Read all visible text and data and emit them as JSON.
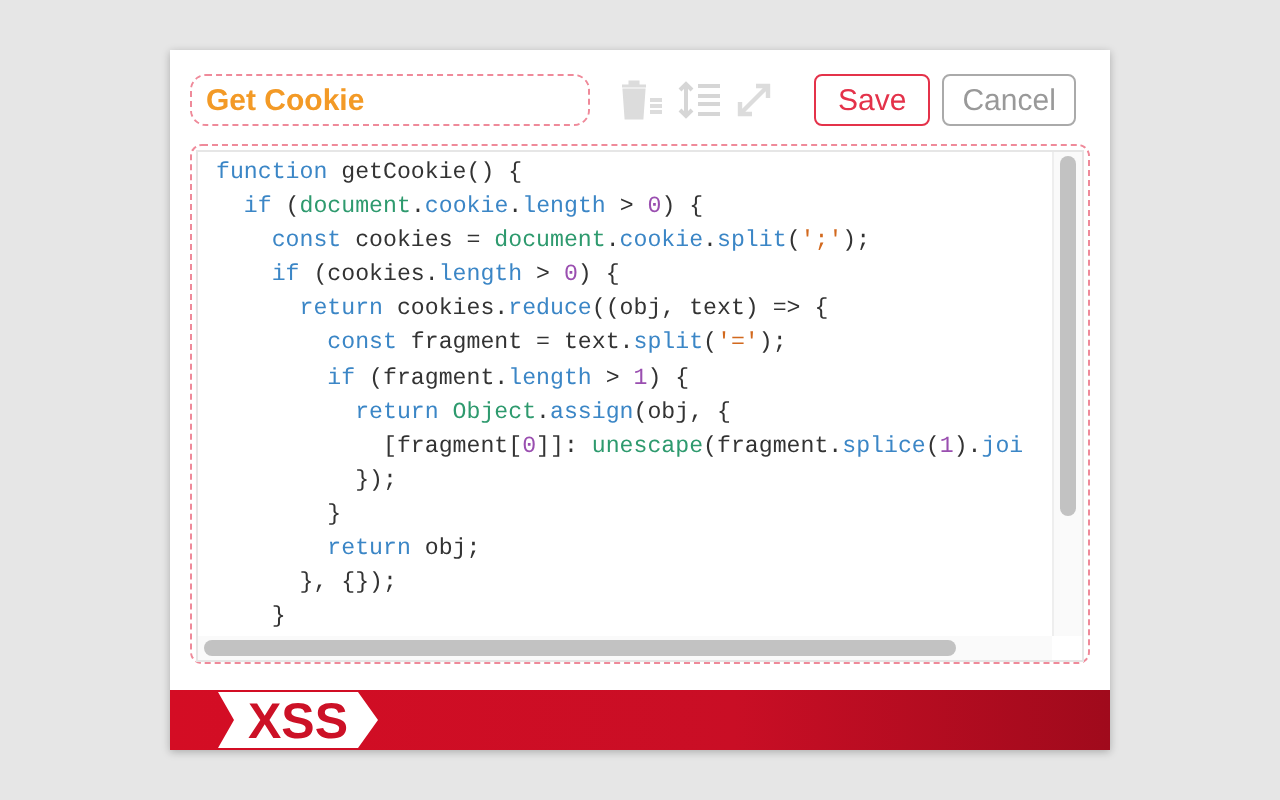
{
  "title_field": {
    "value": "Get Cookie"
  },
  "toolbar": {
    "save": "Save",
    "cancel": "Cancel"
  },
  "code_lines": [
    [
      {
        "t": "function",
        "kind": "keyword"
      },
      {
        "t": " getCookie() {",
        "kind": "plain"
      }
    ],
    [
      {
        "t": "  if",
        "kind": "keyword"
      },
      {
        "t": " (",
        "kind": "plain"
      },
      {
        "t": "document",
        "kind": "global"
      },
      {
        "t": ".",
        "kind": "plain"
      },
      {
        "t": "cookie",
        "kind": "property"
      },
      {
        "t": ".",
        "kind": "plain"
      },
      {
        "t": "length",
        "kind": "property"
      },
      {
        "t": " > ",
        "kind": "plain"
      },
      {
        "t": "0",
        "kind": "number"
      },
      {
        "t": ") {",
        "kind": "plain"
      }
    ],
    [
      {
        "t": "    const",
        "kind": "keyword"
      },
      {
        "t": " cookies = ",
        "kind": "plain"
      },
      {
        "t": "document",
        "kind": "global"
      },
      {
        "t": ".",
        "kind": "plain"
      },
      {
        "t": "cookie",
        "kind": "property"
      },
      {
        "t": ".",
        "kind": "plain"
      },
      {
        "t": "split",
        "kind": "property"
      },
      {
        "t": "(",
        "kind": "plain"
      },
      {
        "t": "';'",
        "kind": "string"
      },
      {
        "t": ");",
        "kind": "plain"
      }
    ],
    [
      {
        "t": "    if",
        "kind": "keyword"
      },
      {
        "t": " (cookies.",
        "kind": "plain"
      },
      {
        "t": "length",
        "kind": "property"
      },
      {
        "t": " > ",
        "kind": "plain"
      },
      {
        "t": "0",
        "kind": "number"
      },
      {
        "t": ") {",
        "kind": "plain"
      }
    ],
    [
      {
        "t": "      return",
        "kind": "keyword"
      },
      {
        "t": " cookies.",
        "kind": "plain"
      },
      {
        "t": "reduce",
        "kind": "property"
      },
      {
        "t": "((obj, text) => {",
        "kind": "plain"
      }
    ],
    [
      {
        "t": "        const",
        "kind": "keyword"
      },
      {
        "t": " fragment = text.",
        "kind": "plain"
      },
      {
        "t": "split",
        "kind": "property"
      },
      {
        "t": "(",
        "kind": "plain"
      },
      {
        "t": "'='",
        "kind": "string"
      },
      {
        "t": ");",
        "kind": "plain"
      }
    ],
    [
      {
        "t": "        if",
        "kind": "keyword"
      },
      {
        "t": " (fragment.",
        "kind": "plain"
      },
      {
        "t": "length",
        "kind": "property"
      },
      {
        "t": " > ",
        "kind": "plain"
      },
      {
        "t": "1",
        "kind": "number"
      },
      {
        "t": ") {",
        "kind": "plain"
      }
    ],
    [
      {
        "t": "          return ",
        "kind": "keyword"
      },
      {
        "t": "Object",
        "kind": "global"
      },
      {
        "t": ".",
        "kind": "plain"
      },
      {
        "t": "assign",
        "kind": "property"
      },
      {
        "t": "(obj, {",
        "kind": "plain"
      }
    ],
    [
      {
        "t": "            [fragment[",
        "kind": "plain"
      },
      {
        "t": "0",
        "kind": "number"
      },
      {
        "t": "]]: ",
        "kind": "plain"
      },
      {
        "t": "unescape",
        "kind": "global"
      },
      {
        "t": "(fragment.",
        "kind": "plain"
      },
      {
        "t": "splice",
        "kind": "property"
      },
      {
        "t": "(",
        "kind": "plain"
      },
      {
        "t": "1",
        "kind": "number"
      },
      {
        "t": ").",
        "kind": "plain"
      },
      {
        "t": "joi",
        "kind": "property"
      }
    ],
    [
      {
        "t": "          });",
        "kind": "plain"
      }
    ],
    [
      {
        "t": "        }",
        "kind": "plain"
      }
    ],
    [
      {
        "t": "        return",
        "kind": "keyword"
      },
      {
        "t": " obj;",
        "kind": "plain"
      }
    ],
    [
      {
        "t": "      }, {});",
        "kind": "plain"
      }
    ],
    [
      {
        "t": "    }",
        "kind": "plain"
      }
    ]
  ],
  "footer": {
    "logo": "XSS"
  }
}
